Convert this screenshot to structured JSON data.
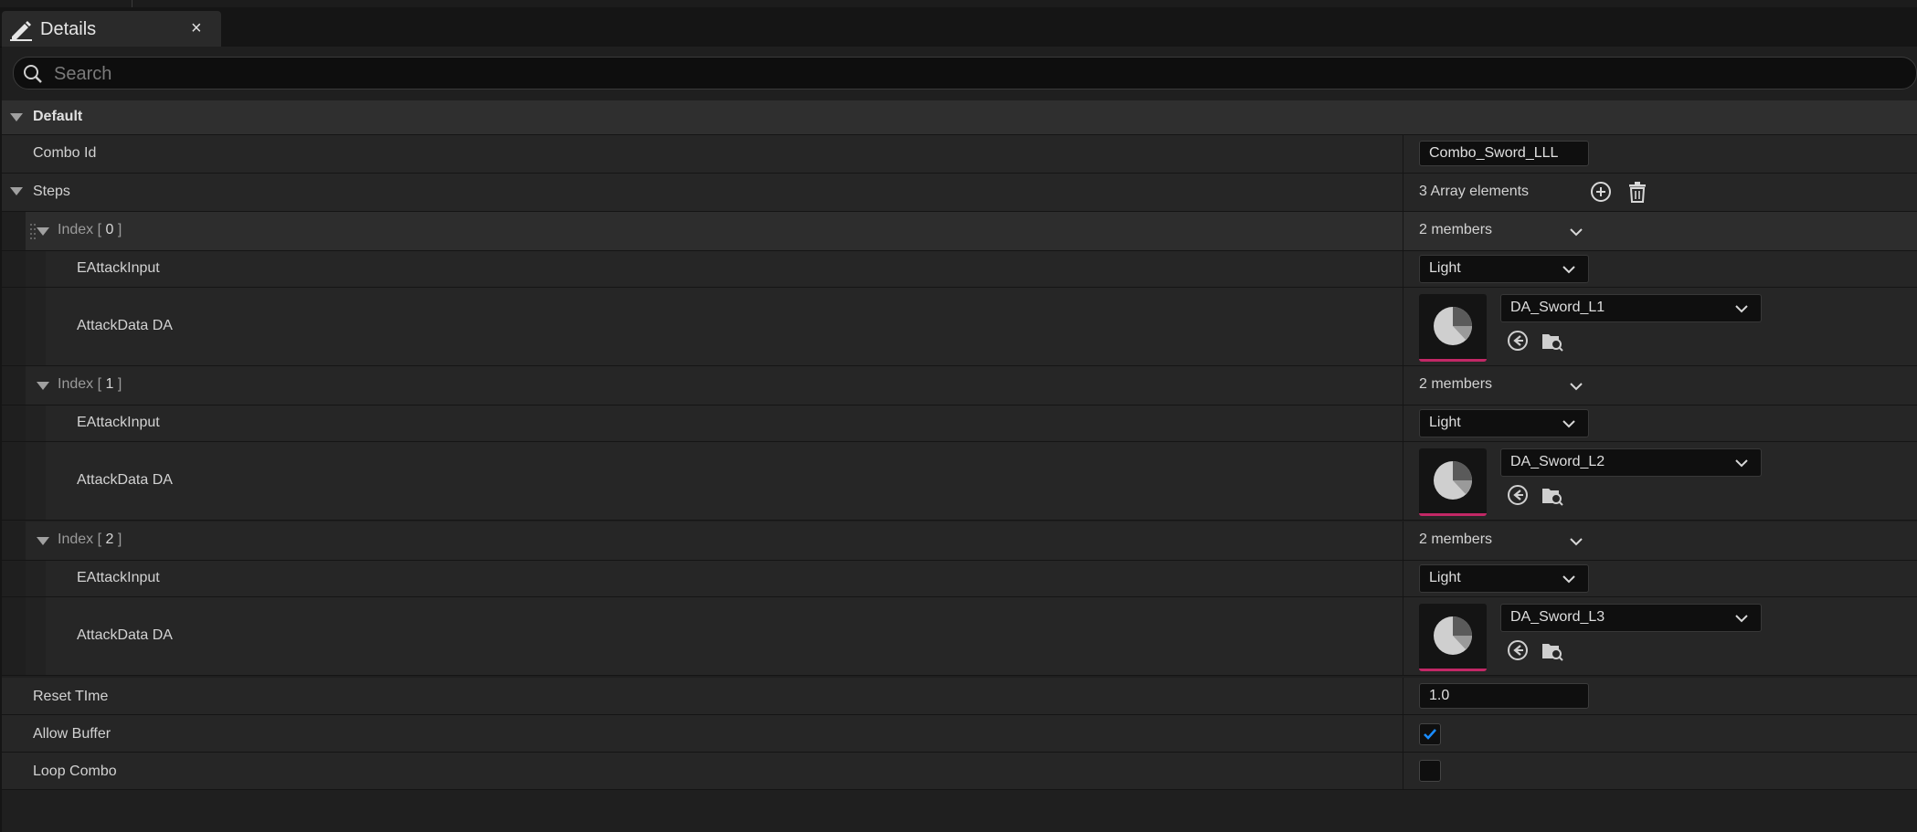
{
  "tab": {
    "title": "Details",
    "close": "×",
    "icon": "pencil-icon"
  },
  "search": {
    "placeholder": "Search",
    "value": ""
  },
  "category": {
    "label": "Default"
  },
  "combo_id": {
    "label": "Combo Id",
    "value": "Combo_Sword_LLL"
  },
  "steps": {
    "label": "Steps",
    "count_text": "3 Array elements",
    "add_icon": "add-element-icon",
    "delete_icon": "delete-all-icon",
    "items": [
      {
        "index_prefix": "Index [ ",
        "index_num": "0",
        "index_suffix": " ]",
        "members": "2 members",
        "input_label": "EAttackInput",
        "input_value": "Light",
        "data_label": "AttackData DA",
        "data_value": "DA_Sword_L1"
      },
      {
        "index_prefix": "Index [ ",
        "index_num": "1",
        "index_suffix": " ]",
        "members": "2 members",
        "input_label": "EAttackInput",
        "input_value": "Light",
        "data_label": "AttackData DA",
        "data_value": "DA_Sword_L2"
      },
      {
        "index_prefix": "Index [ ",
        "index_num": "2",
        "index_suffix": " ]",
        "members": "2 members",
        "input_label": "EAttackInput",
        "input_value": "Light",
        "data_label": "AttackData DA",
        "data_value": "DA_Sword_L3"
      }
    ]
  },
  "reset_time": {
    "label": "Reset TIme",
    "value": "1.0"
  },
  "allow_buffer": {
    "label": "Allow Buffer",
    "checked": true
  },
  "loop_combo": {
    "label": "Loop Combo",
    "checked": false
  },
  "colors": {
    "accent": "#1a8cff",
    "asset_underline": "#c22866",
    "background": "#1f1f1f"
  }
}
